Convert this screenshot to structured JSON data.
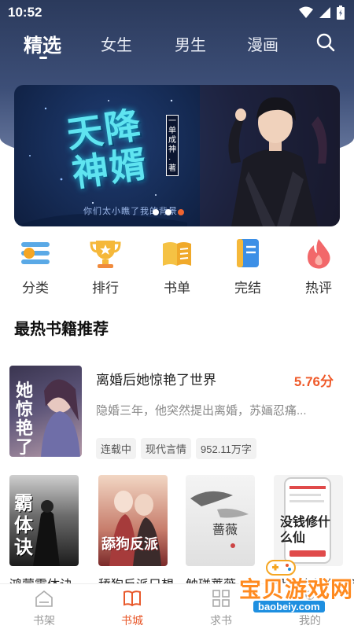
{
  "status": {
    "time": "10:52"
  },
  "nav_tabs": [
    {
      "label": "精选",
      "active": true
    },
    {
      "label": "女生"
    },
    {
      "label": "男生"
    },
    {
      "label": "漫画"
    }
  ],
  "banner": {
    "title": "天降神婿",
    "author": "一单成神·著",
    "tagline": "你们太小瞧了我的背景",
    "dots": 3,
    "active_dot": 2
  },
  "quick_menu": [
    {
      "label": "分类",
      "icon": "category-icon"
    },
    {
      "label": "排行",
      "icon": "trophy-icon"
    },
    {
      "label": "书单",
      "icon": "book-list-icon"
    },
    {
      "label": "完结",
      "icon": "finished-book-icon"
    },
    {
      "label": "热评",
      "icon": "flame-icon"
    }
  ],
  "section": {
    "title": "最热书籍推荐"
  },
  "featured_book": {
    "title": "离婚后她惊艳了世界",
    "score": "5.76分",
    "description": "隐婚三年，他突然提出离婚，苏婳忍痛...",
    "tags": [
      "连载中",
      "现代言情",
      "952.11万字"
    ],
    "cover_text": "她惊艳了世界"
  },
  "book_row": [
    {
      "title": "鸿蒙霸体诀",
      "cover_text": "霸体诀"
    },
    {
      "title": "舔狗反派只想",
      "cover_text": "舔狗反派"
    },
    {
      "title": "触碰蔷薇",
      "cover_text": "蔷薇"
    },
    {
      "title": "没钱修什么仙？",
      "cover_text": "没钱修什么仙"
    }
  ],
  "bottom_nav": [
    {
      "label": "书架",
      "icon": "bookshelf-icon"
    },
    {
      "label": "书城",
      "icon": "book-city-icon",
      "active": true
    },
    {
      "label": "求书",
      "icon": "request-book-icon"
    },
    {
      "label": "我的",
      "icon": "profile-icon"
    }
  ],
  "watermark": {
    "text": "宝贝游戏网",
    "url": "baobeiy.com"
  },
  "colors": {
    "accent": "#ef5a2a",
    "header": "#2b3a5c",
    "active_dot": "#f06530"
  }
}
